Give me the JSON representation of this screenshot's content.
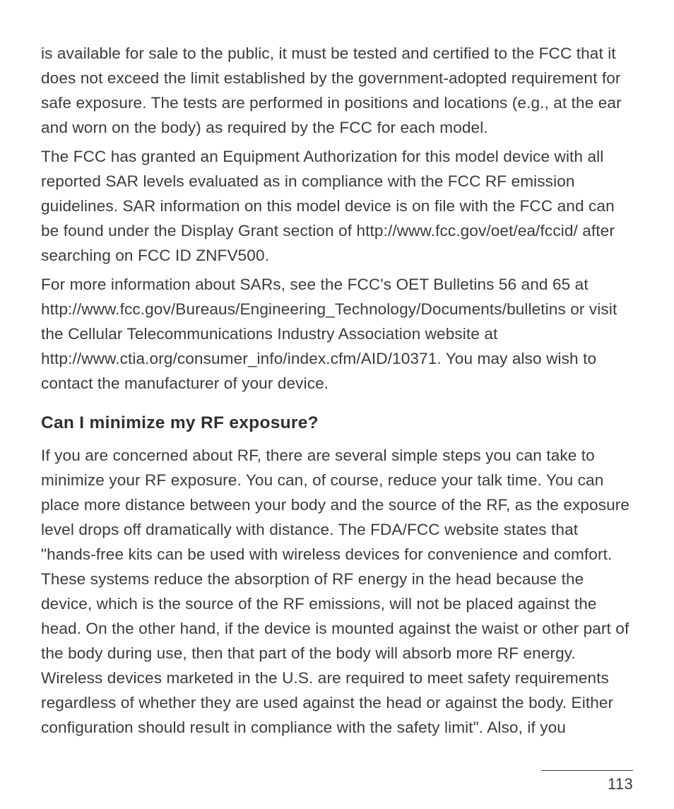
{
  "paragraphs": {
    "p1": "is available for sale to the public, it must be tested and certified to the FCC that it does not exceed the limit established by the government-adopted requirement for safe exposure. The tests are performed in positions and locations (e.g., at the ear and worn on the body) as required by the FCC for each model.",
    "p2": "The FCC has granted an Equipment Authorization for this model device with all reported SAR levels evaluated as in compliance with the FCC RF emission guidelines. SAR information on this model device is on file with the FCC and can be found under the Display Grant section of http://www.fcc.gov/oet/ea/fccid/ after searching on FCC ID ZNFV500.",
    "p3": "For more information about SARs, see the FCC's OET Bulletins 56 and 65 at http://www.fcc.gov/Bureaus/Engineering_Technology/Documents/bulletins or visit the Cellular Telecommunications Industry Association website at http://www.ctia.org/consumer_info/index.cfm/AID/10371. You may also wish to contact the manufacturer of your device."
  },
  "heading": "Can I minimize my RF exposure?",
  "paragraphs2": {
    "p4": "If you are concerned about RF, there are several simple steps you can take to minimize your RF exposure. You can, of course, reduce your talk time. You can place more distance between your body and the source of the RF, as the exposure level drops off dramatically with distance. The FDA/FCC website states that \"hands-free kits can be used with wireless devices for convenience and comfort. These systems reduce the absorption of RF energy in the head because the device, which is the source of the RF emissions, will not be placed against the head. On the other hand, if the device is mounted against the waist or other part of the body during use, then that part of the body will absorb more RF energy. Wireless devices marketed in the U.S. are required to meet safety requirements regardless of whether they are used against the head or against the body. Either configuration should result in compliance with the safety limit\". Also, if you"
  },
  "page_number": "113"
}
